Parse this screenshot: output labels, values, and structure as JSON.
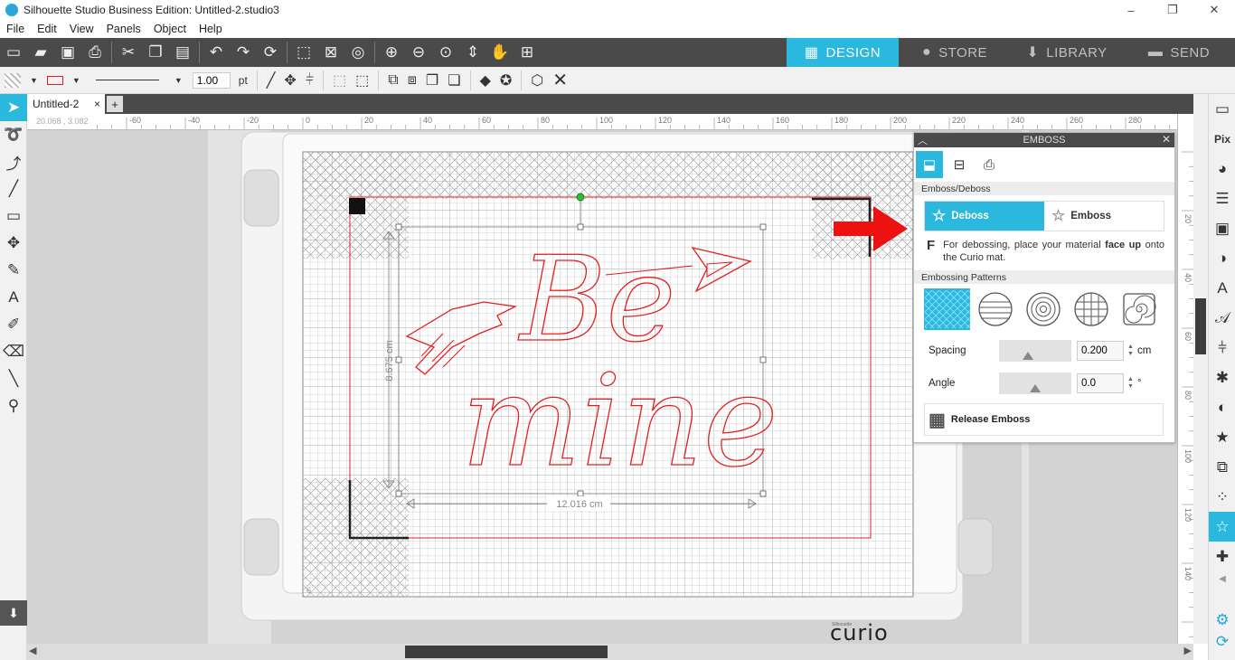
{
  "window": {
    "title": "Silhouette Studio Business Edition: Untitled-2.studio3",
    "controls": [
      "–",
      "❐",
      "✕"
    ]
  },
  "menu": [
    "File",
    "Edit",
    "View",
    "Panels",
    "Object",
    "Help"
  ],
  "mode_tabs": [
    {
      "label": "DESIGN",
      "icon": "grid-icon",
      "active": true
    },
    {
      "label": "STORE",
      "icon": "s-logo-icon",
      "active": false
    },
    {
      "label": "LIBRARY",
      "icon": "download-icon",
      "active": false
    },
    {
      "label": "SEND",
      "icon": "cutter-icon",
      "active": false
    }
  ],
  "line_toolbar": {
    "line_width": "1.00",
    "unit": "pt"
  },
  "document": {
    "tab_name": "Untitled-2",
    "close": "×",
    "new_tab": "+",
    "coords": "20.068 , 3.082"
  },
  "ruler_h": [
    -60,
    -40,
    -20,
    0,
    20,
    40,
    60,
    80,
    100,
    120,
    140,
    160,
    180,
    200,
    220,
    240,
    260,
    280
  ],
  "ruler_v": [
    20,
    40,
    60,
    80,
    100,
    120,
    140
  ],
  "canvas": {
    "design_text": [
      "Be",
      "mine"
    ],
    "dim_width": "12.016 cm",
    "dim_height": "8.675 cm",
    "page_number": "6",
    "brand_small": "Silhouette",
    "brand": "curio"
  },
  "emboss_panel": {
    "title": "EMBOSS",
    "section_emboss_deboss": "Emboss/Deboss",
    "deboss_label": "Deboss",
    "emboss_label": "Emboss",
    "hint_letter": "F",
    "hint_text_a": "For debossing, place your material ",
    "hint_text_bold": "face up",
    "hint_text_b": " onto the Curio mat.",
    "section_patterns": "Embossing Patterns",
    "patterns": [
      "crosshatch",
      "horizontal-lines",
      "concentric-circles",
      "grid-circle",
      "spiral-square"
    ],
    "spacing_label": "Spacing",
    "spacing_value": "0.200",
    "spacing_unit": "cm",
    "angle_label": "Angle",
    "angle_value": "0.0",
    "angle_unit": "°",
    "release_label": "Release Emboss"
  },
  "colors": {
    "accent": "#2bb8de",
    "toolbar": "#4a4a4a",
    "cut_line": "#e02020"
  }
}
